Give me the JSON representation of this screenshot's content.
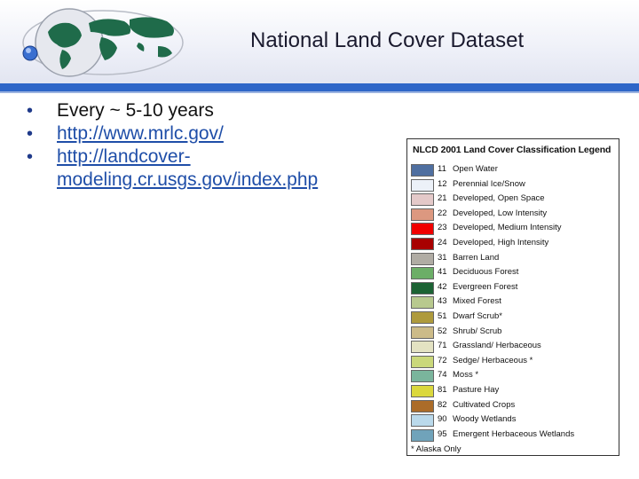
{
  "slide": {
    "title": "National Land Cover Dataset",
    "bullets": [
      {
        "text": "Every ~ 5-10 years",
        "link": false
      },
      {
        "text": "http://www.mrlc.gov/",
        "link": true
      },
      {
        "text": "http://landcover-modeling.cr.usgs.gov/index.php",
        "link": true
      }
    ]
  },
  "legend": {
    "title": "NLCD 2001 Land Cover Classification Legend",
    "entries": [
      {
        "code": "11",
        "label": "Open Water",
        "color": "#4f6fa0"
      },
      {
        "code": "12",
        "label": "Perennial Ice/Snow",
        "color": "#ecf1f8"
      },
      {
        "code": "21",
        "label": "Developed, Open Space",
        "color": "#e4c9c9"
      },
      {
        "code": "22",
        "label": "Developed, Low Intensity",
        "color": "#dc9880"
      },
      {
        "code": "23",
        "label": "Developed, Medium Intensity",
        "color": "#f00000"
      },
      {
        "code": "24",
        "label": "Developed, High Intensity",
        "color": "#a80000"
      },
      {
        "code": "31",
        "label": "Barren Land",
        "color": "#b0aca4"
      },
      {
        "code": "41",
        "label": "Deciduous Forest",
        "color": "#6cae67"
      },
      {
        "code": "42",
        "label": "Evergreen Forest",
        "color": "#1c6334"
      },
      {
        "code": "43",
        "label": "Mixed Forest",
        "color": "#b8c98e"
      },
      {
        "code": "51",
        "label": "Dwarf Scrub*",
        "color": "#ae9a3c"
      },
      {
        "code": "52",
        "label": "Shrub/ Scrub",
        "color": "#ccbb88"
      },
      {
        "code": "71",
        "label": "Grassland/ Herbaceous",
        "color": "#e3e2c2"
      },
      {
        "code": "72",
        "label": "Sedge/ Herbaceous *",
        "color": "#cad87a"
      },
      {
        "code": "74",
        "label": "Moss *",
        "color": "#7ab59c"
      },
      {
        "code": "81",
        "label": "Pasture Hay",
        "color": "#dbd83d"
      },
      {
        "code": "82",
        "label": "Cultivated Crops",
        "color": "#ab6c29"
      },
      {
        "code": "90",
        "label": "Woody Wetlands",
        "color": "#bad9eb"
      },
      {
        "code": "95",
        "label": "Emergent Herbaceous Wetlands",
        "color": "#70a3ba"
      }
    ],
    "footnote": "* Alaska Only"
  },
  "colors": {
    "accent_bar": "#2e66c8",
    "link": "#1f4ea8"
  },
  "icons": {
    "logo": "globe-world-map-icon"
  }
}
